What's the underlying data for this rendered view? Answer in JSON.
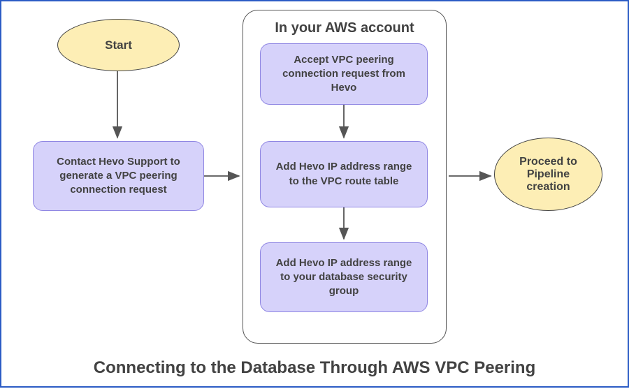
{
  "start": {
    "label": "Start"
  },
  "step1": {
    "label": "Contact Hevo Support to generate a VPC peering connection request"
  },
  "aws_frame": {
    "title": "In your AWS account"
  },
  "step2": {
    "label": "Accept VPC peering connection request from Hevo"
  },
  "step3": {
    "label": "Add Hevo IP address range to the VPC route table"
  },
  "step4": {
    "label": "Add Hevo IP address range to your database security group"
  },
  "end": {
    "label": "Proceed to Pipeline creation"
  },
  "caption": "Connecting to the Database Through AWS VPC Peering"
}
